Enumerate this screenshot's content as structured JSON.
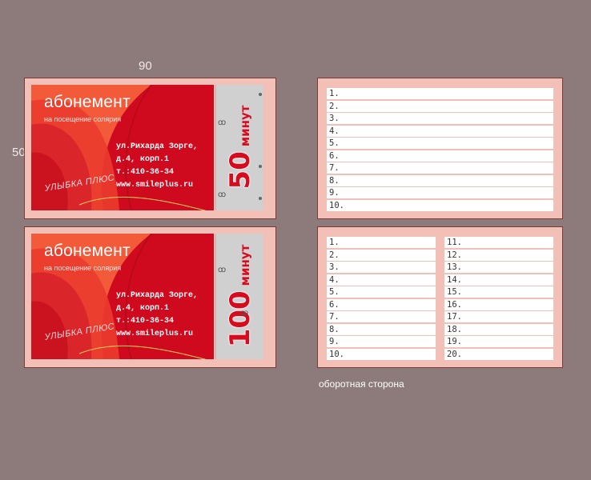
{
  "dimensions": {
    "width_label": "90",
    "height_label": "50"
  },
  "front_cards": [
    {
      "title": "абонемент",
      "subtitle": "на посещение солярия",
      "address_lines": [
        "ул.Рихарда Зорге,",
        "д.4, корп.1",
        "т.:410-36-34",
        "www.smileplus.ru"
      ],
      "brand": "УЛЫБКА ПЛЮС",
      "minutes": "50",
      "minutes_unit": "минут"
    },
    {
      "title": "абонемент",
      "subtitle": "на посещение солярия",
      "address_lines": [
        "ул.Рихарда Зорге,",
        "д.4, корп.1",
        "т.:410-36-34",
        "www.smileplus.ru"
      ],
      "brand": "УЛЫБКА ПЛЮС",
      "minutes": "100",
      "minutes_unit": "минут"
    }
  ],
  "back_cards": [
    {
      "entries": [
        "1.",
        "2.",
        "3.",
        "4.",
        "5.",
        "6.",
        "7.",
        "8.",
        "9.",
        "10."
      ]
    },
    {
      "left": [
        "1.",
        "2.",
        "3.",
        "4.",
        "5.",
        "6.",
        "7.",
        "8.",
        "9.",
        "10."
      ],
      "right": [
        "11.",
        "12.",
        "13.",
        "14.",
        "15.",
        "16.",
        "17.",
        "18.",
        "19.",
        "20."
      ]
    }
  ],
  "caption": "оборотная сторона",
  "colors": {
    "background": "#8c7b7a",
    "card_border": "#f2c0b6",
    "red": "#cf0a1e",
    "stub": "#d0d0d0"
  }
}
